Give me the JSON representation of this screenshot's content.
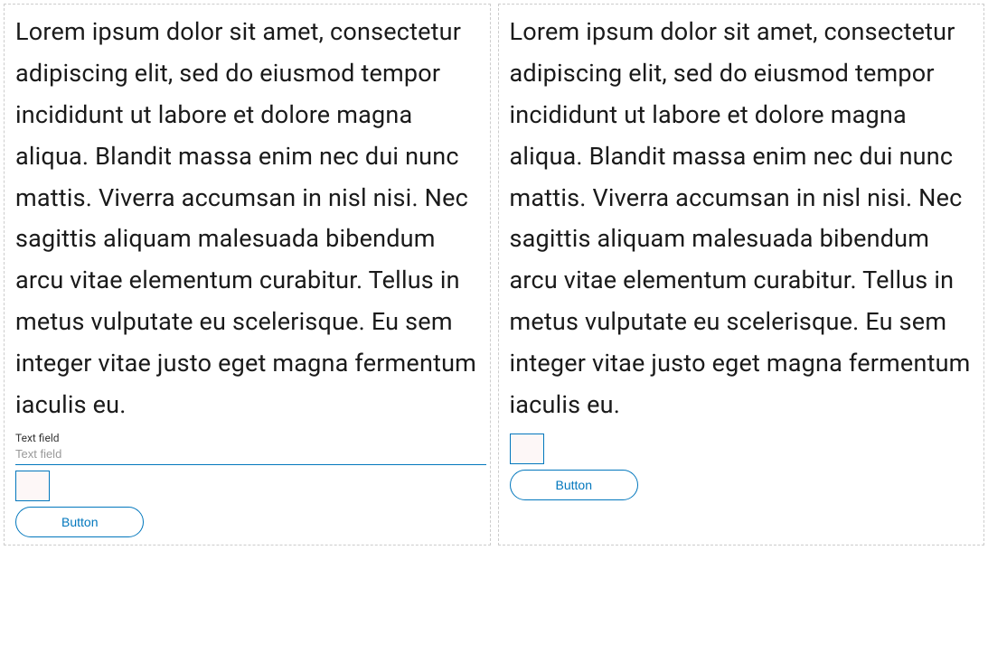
{
  "left": {
    "paragraph": "Lorem ipsum dolor sit amet, consectetur adipiscing elit, sed do eiusmod tempor incididunt ut labore et dolore magna aliqua. Blandit massa enim nec dui nunc mattis. Viverra accumsan in nisl nisi. Nec sagittis aliquam malesuada bibendum arcu vitae elementum curabitur. Tellus in metus vulputate eu scelerisque. Eu sem integer vitae justo eget magna fermentum iaculis eu.",
    "textfield": {
      "label": "Text field",
      "placeholder": "Text field"
    },
    "button_label": "Button"
  },
  "right": {
    "paragraph": "Lorem ipsum dolor sit amet, consectetur adipiscing elit, sed do eiusmod tempor incididunt ut labore et dolore magna aliqua. Blandit massa enim nec dui nunc mattis. Viverra accumsan in nisl nisi. Nec sagittis aliquam malesuada bibendum arcu vitae elementum curabitur. Tellus in metus vulputate eu scelerisque. Eu sem integer vitae justo eget magna fermentum iaculis eu.",
    "button_label": "Button"
  },
  "colors": {
    "accent": "#0277bd",
    "border_dashed": "#cccccc",
    "checkbox_fill": "#fdf7f7"
  }
}
